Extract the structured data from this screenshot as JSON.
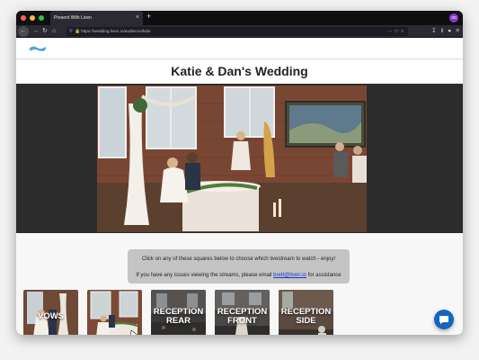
{
  "browser": {
    "tab_title": "Present With Liven",
    "tab_close": "×",
    "new_tab": "+",
    "url": "https://wedding.liven.io/audience/kdw",
    "profile_initial": "oo"
  },
  "page": {
    "title": "Katie & Dan's Wedding",
    "instructions": "Click on any of these squares below to choose which livestream to watch - enjoy!",
    "support_text_before": "If you have any issues viewing the streams, please email",
    "support_email": "brett@liven.io",
    "support_text_after": "for assistance"
  },
  "streams": [
    {
      "label_line1": "VOWS",
      "label_line2": ""
    },
    {
      "label_line1": "",
      "label_line2": ""
    },
    {
      "label_line1": "RECEPTION",
      "label_line2": "REAR"
    },
    {
      "label_line1": "RECEPTION",
      "label_line2": "FRONT"
    },
    {
      "label_line1": "RECEPTION",
      "label_line2": "SIDE"
    }
  ],
  "colors": {
    "accent": "#1565c0",
    "link": "#1a33cc",
    "band": "#2c2c2c"
  },
  "icons": [
    "back-icon",
    "forward-icon",
    "reload-icon",
    "home-icon",
    "shield-icon",
    "lock-icon",
    "more-icon",
    "pocket-icon",
    "bookmark-star-icon",
    "download-icon",
    "library-icon",
    "account-icon",
    "menu-icon",
    "chat-icon"
  ]
}
